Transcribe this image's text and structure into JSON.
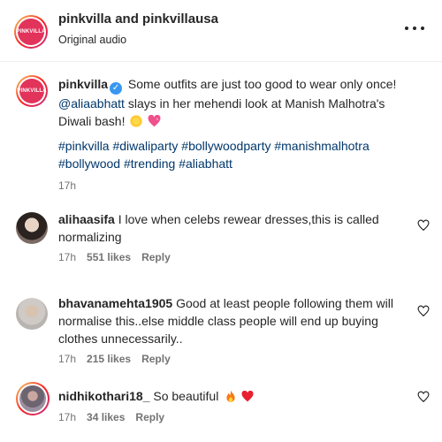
{
  "header": {
    "account_primary": "pinkvilla",
    "and_text": "and",
    "account_secondary": "pinkvillausa",
    "audio": "Original audio",
    "logo_text": "PINKVILLA"
  },
  "caption": {
    "username": "pinkvilla",
    "text_1": "Some outfits are just too good to wear only once!",
    "mention": "@aliaabhatt",
    "text_2": "slays in her mehendi look at Manish Malhotra's Diwali bash!",
    "hashtags_line1": "#pinkvilla #diwaliparty #bollywoodparty #manishmalhotra",
    "hashtags_line2": "#bollywood #trending #aliabhatt",
    "time": "17h",
    "logo_text": "PINKVILLA"
  },
  "comments": [
    {
      "username": "alihaasifa",
      "text": "I love when celebs rewear dresses,this is called normalizing",
      "time": "17h",
      "likes": "551 likes",
      "reply": "Reply"
    },
    {
      "username": "bhavanamehta1905",
      "text": "Good at least people following them will normalise this..else middle class people will end up buying clothes unnecessarily..",
      "time": "17h",
      "likes": "215 likes",
      "reply": "Reply"
    },
    {
      "username": "nidhikothari18_",
      "text": "So beautiful",
      "time": "17h",
      "likes": "34 likes",
      "reply": "Reply"
    }
  ],
  "colors": {
    "brand_pink": "#e2335b",
    "link": "#00376b",
    "muted": "#737373",
    "text": "#262626"
  },
  "icons": [
    "more-icon",
    "verified-icon",
    "heart-outline-icon",
    "sparkle-emoji",
    "pink-heart-emoji",
    "fire-emoji",
    "red-heart-emoji"
  ]
}
